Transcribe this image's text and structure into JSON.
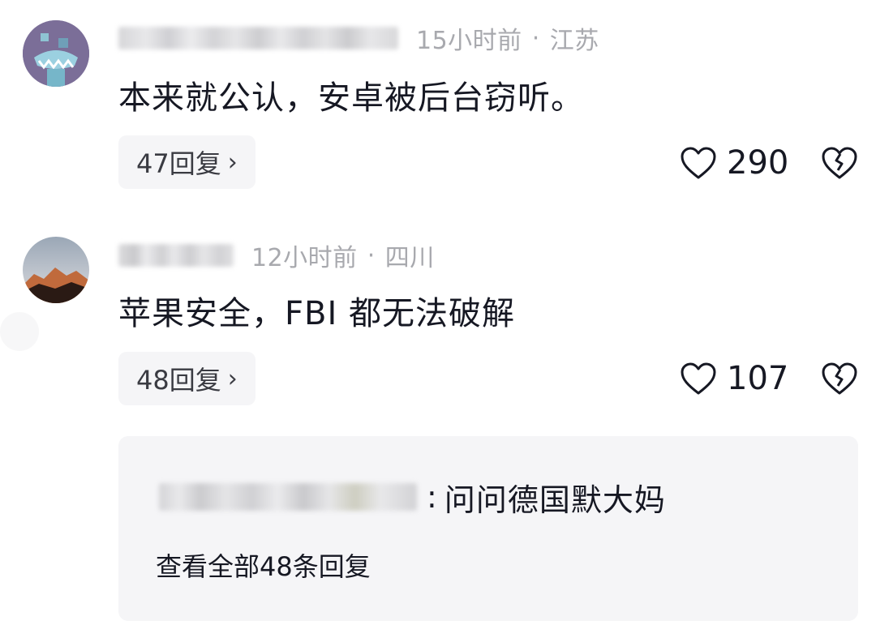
{
  "comments": [
    {
      "username": "",
      "timestamp": "15小时前",
      "location": "江苏",
      "text": "本来就公认，安卓被后台窃听。",
      "replies_label": "47回复",
      "likes": "290",
      "avatar_icon": "cartoon-avatar-icon"
    },
    {
      "username": "",
      "timestamp": "12小时前",
      "location": "四川",
      "text": "苹果安全，FBI 都无法破解",
      "replies_label": "48回复",
      "likes": "107",
      "avatar_icon": "mountain-sunset-avatar-icon"
    }
  ],
  "reply_preview": {
    "author": "",
    "separator": ":",
    "text": "问问德国默大妈",
    "view_all_label": "查看全部48条回复"
  },
  "meta_separator": "·",
  "chevron": "›",
  "colors": {
    "meta_gray": "#a8a9ae",
    "chip_bg": "#f5f5f7",
    "text_primary": "#161823"
  }
}
